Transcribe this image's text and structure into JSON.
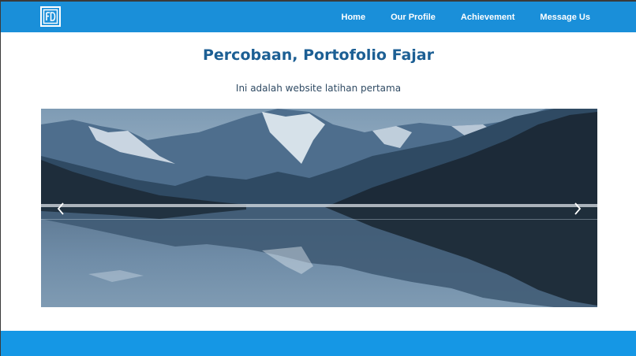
{
  "navbar": {
    "logo_icon": "fd-monogram-logo-icon",
    "links": [
      {
        "label": "Home"
      },
      {
        "label": "Our Profile"
      },
      {
        "label": "Achievement"
      },
      {
        "label": "Message Us"
      }
    ]
  },
  "hero": {
    "title": "Percobaan, Portofolio Fajar",
    "subtitle": "Ini adalah website latihan pertama"
  },
  "carousel": {
    "image_subject": "mountain lake reflection",
    "prev_icon": "chevron-left-icon",
    "next_icon": "chevron-right-icon"
  },
  "colors": {
    "navbar": "#1a8fd9",
    "title": "#1c5f94",
    "footer": "#1597e5"
  }
}
